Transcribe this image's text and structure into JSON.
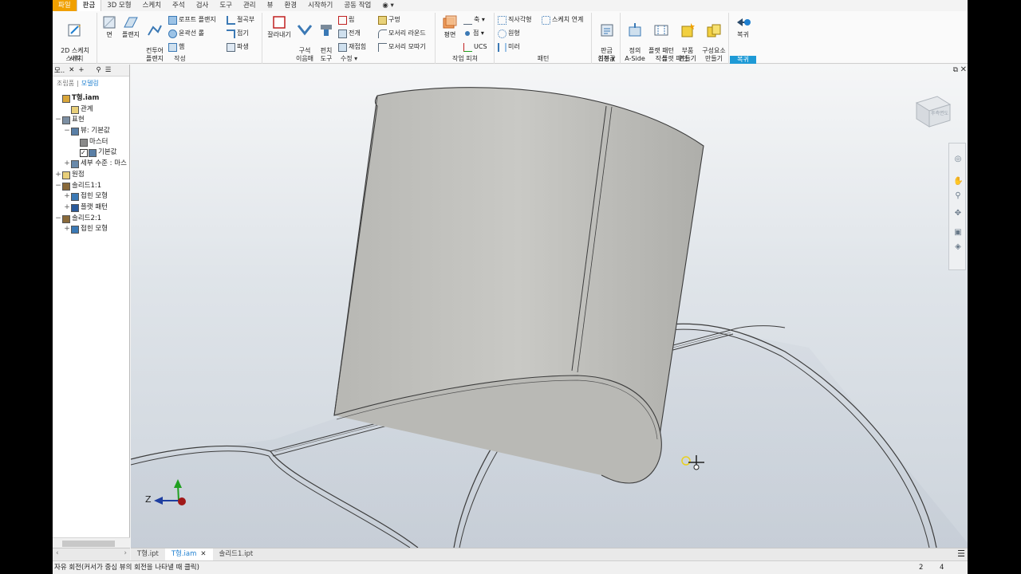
{
  "menu": {
    "tabs": [
      "파일",
      "판금",
      "3D 모형",
      "스케치",
      "주석",
      "검사",
      "도구",
      "관리",
      "뷰",
      "환경",
      "시작하기",
      "공동 작업"
    ],
    "active": "판금",
    "extra": "◉ ▾"
  },
  "ribbon": {
    "sketch": {
      "start_2d": "2D 스케치\n시작",
      "title": "스케치"
    },
    "create": {
      "face": "면",
      "flange": "플랜지",
      "contour_flange": "컨투어\n플랜지",
      "loft_flange": "로프트 플랜지",
      "contour_roll": "윤곽선 롤",
      "hem": "햄",
      "bend": "절곡부",
      "fold": "접기",
      "derive": "파생",
      "title": "작성"
    },
    "modify": {
      "cut": "잘라내기",
      "unfold_fold": "구석\n이음매",
      "rip": "립",
      "unfold": "전개",
      "refold": "재접힘",
      "bend_tools": "펀치\n도구",
      "hole": "구멍",
      "corner_round": "모서리 라운드",
      "corner_chamfer": "모서리 모따기",
      "title": "수정 ▾"
    },
    "work_features": {
      "plane": "평면",
      "axis": "축 ▾",
      "point": "점 ▾",
      "ucs": "UCS",
      "title": "작업 피쳐"
    },
    "pattern": {
      "rectangular": "직사각형",
      "sketch_driven": "스케치 연계",
      "circular": "원형",
      "mirror": "미러",
      "title": "패턴"
    },
    "setup": {
      "sheet_metal_defaults": "판금\n기본값",
      "title": "설정 ▾"
    },
    "flat_pattern": {
      "define_a_side": "정의\nA-Side",
      "create_flat": "플랫 패턴\n작성",
      "make_part": "부품\n만들기",
      "make_components": "구성요소\n만들기",
      "title": "플랫 패턴"
    },
    "return": {
      "return": "복귀",
      "title": "복귀"
    }
  },
  "browser": {
    "tab_label": "모..",
    "subtabs": [
      "조립품",
      "모델링"
    ],
    "active_subtab": "모델링",
    "tree": [
      {
        "toggle": "",
        "label": "T형.iam",
        "icon": "assembly-icon",
        "indent": 0,
        "bold": true
      },
      {
        "toggle": "",
        "label": "관계",
        "icon": "folder-icon",
        "indent": 1
      },
      {
        "toggle": "−",
        "label": "표현",
        "icon": "representation-icon",
        "indent": 0
      },
      {
        "toggle": "−",
        "label": "뷰: 기본값",
        "icon": "view-icon",
        "indent": 1
      },
      {
        "toggle": "",
        "label": "마스터",
        "icon": "lock-icon",
        "indent": 2
      },
      {
        "toggle": "",
        "label": "기본값",
        "icon": "checkbox-view-icon",
        "indent": 2,
        "checked": true
      },
      {
        "toggle": "+",
        "label": "세부 수준 : 마스",
        "icon": "level-of-detail-icon",
        "indent": 1
      },
      {
        "toggle": "+",
        "label": "원점",
        "icon": "folder-icon",
        "indent": 0
      },
      {
        "toggle": "−",
        "label": "솔리드1:1",
        "icon": "solid-part-icon",
        "indent": 0
      },
      {
        "toggle": "+",
        "label": "접힌 모형",
        "icon": "folded-model-icon",
        "indent": 1
      },
      {
        "toggle": "+",
        "label": "플랫 패턴",
        "icon": "flat-pattern-icon",
        "indent": 1
      },
      {
        "toggle": "−",
        "label": "솔리드2:1",
        "icon": "solid-part-icon",
        "indent": 0
      },
      {
        "toggle": "+",
        "label": "접힌 모형",
        "icon": "folded-model-icon",
        "indent": 1
      }
    ]
  },
  "viewcube": {
    "face_label": "후측면도"
  },
  "triad": {
    "z_label": "Z"
  },
  "doc_tabs": [
    {
      "label": "T형.ipt",
      "active": false
    },
    {
      "label": "T형.iam",
      "active": true,
      "close": "✕"
    },
    {
      "label": "솔리드1.ipt",
      "active": false
    }
  ],
  "status": {
    "message": "자유 회전(커서가 중심 뷰의 회전을 나타낼 때 클릭)",
    "num1": "2",
    "num2": "4"
  },
  "colors": {
    "file_tab": "#f0a000",
    "accent_blue": "#1e9ad6",
    "part_fill": "#c4c4c0"
  }
}
